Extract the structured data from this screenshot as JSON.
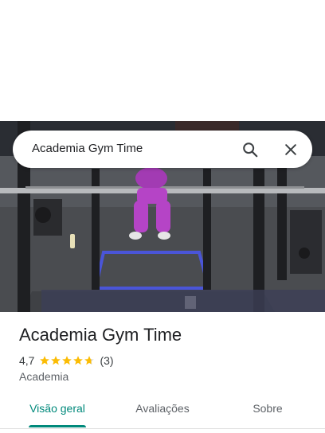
{
  "search": {
    "query": "Academia Gym Time",
    "search_icon": "search-icon",
    "close_icon": "close-icon"
  },
  "photo": {
    "icon": "gym-photo"
  },
  "place": {
    "name": "Academia Gym Time",
    "rating": "4,7",
    "rating_value": 4.7,
    "reviews_count": "(3)",
    "category": "Academia",
    "star_color": "#fbbc04"
  },
  "tabs": [
    {
      "label": "Visão geral",
      "active": true
    },
    {
      "label": "Avaliações",
      "active": false
    },
    {
      "label": "Sobre",
      "active": false
    }
  ],
  "colors": {
    "accent": "#00897b",
    "text_primary": "#202124",
    "text_secondary": "#5f6368"
  }
}
